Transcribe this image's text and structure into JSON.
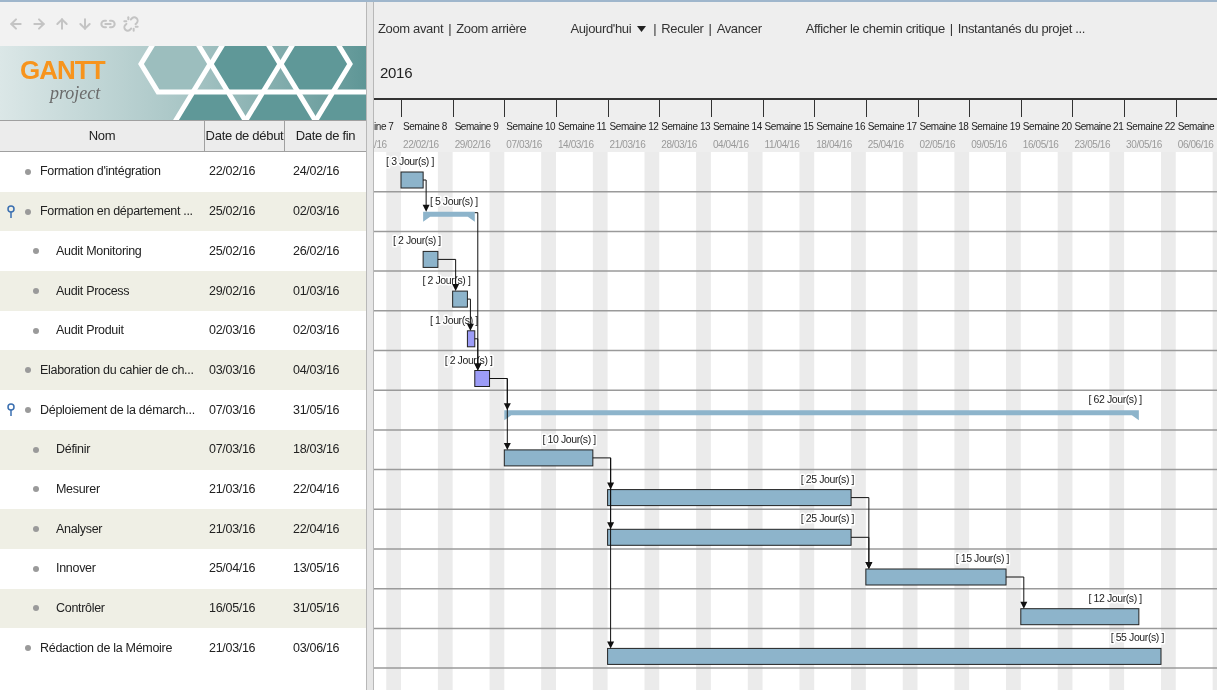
{
  "toolbar": [
    {
      "disabled": true
    },
    {
      "disabled": true
    },
    {
      "disabled": true
    },
    {
      "disabled": true
    },
    {
      "disabled": true
    },
    {
      "disabled": true
    }
  ],
  "logo": {
    "title": "GANTT",
    "subtitle": "project"
  },
  "table": {
    "columns": [
      "Nom",
      "Date de début",
      "Date de fin"
    ],
    "rows": [
      {
        "name": "Formation d'intégration",
        "start": "22/02/16",
        "end": "24/02/16",
        "duration": "[ 3 Jour(s) ]",
        "color": "#8db4cb",
        "arrow_in": false
      },
      {
        "name": "Formation en département ...",
        "start": "25/02/16",
        "end": "02/03/16",
        "duration": "[ 5 Jour(s) ]",
        "arrow_in": true,
        "expanded": true,
        "children": [
          {
            "name": "Audit Monitoring",
            "start": "25/02/16",
            "end": "26/02/16",
            "duration": "[ 2 Jour(s) ]",
            "color": "#8db4cb",
            "arrow_in": false
          },
          {
            "name": "Audit Process",
            "start": "29/02/16",
            "end": "01/03/16",
            "duration": "[ 2 Jour(s) ]",
            "color": "#8db4cb",
            "arrow_in": true
          },
          {
            "name": "Audit Produit",
            "start": "02/03/16",
            "end": "02/03/16",
            "duration": "[ 1 Jour(s) ]",
            "color": "#9c9cf7",
            "arrow_in": true
          }
        ]
      },
      {
        "name": "Elaboration du cahier de ch...",
        "start": "03/03/16",
        "end": "04/03/16",
        "duration": "[ 2 Jour(s) ]",
        "color": "#9c9cf7",
        "arrow_in": true
      },
      {
        "name": "Déploiement de la démarch...",
        "start": "07/03/16",
        "end": "31/05/16",
        "duration": "[ 62 Jour(s) ]",
        "arrow_in": true,
        "expanded": true,
        "children": [
          {
            "name": "Définir",
            "start": "07/03/16",
            "end": "18/03/16",
            "duration": "[ 10 Jour(s) ]",
            "color": "#8db4cb",
            "arrow_in": true
          },
          {
            "name": "Mesurer",
            "start": "21/03/16",
            "end": "22/04/16",
            "duration": "[ 25 Jour(s) ]",
            "color": "#8db4cb",
            "arrow_in": true
          },
          {
            "name": "Analyser",
            "start": "21/03/16",
            "end": "22/04/16",
            "duration": "[ 25 Jour(s) ]",
            "color": "#8db4cb",
            "arrow_in": true
          },
          {
            "name": "Innover",
            "start": "25/04/16",
            "end": "13/05/16",
            "duration": "[ 15 Jour(s) ]",
            "color": "#8db4cb",
            "arrow_in": true
          },
          {
            "name": "Contrôler",
            "start": "16/05/16",
            "end": "31/05/16",
            "duration": "[ 12 Jour(s) ]",
            "color": "#8db4cb",
            "arrow_in": true
          }
        ]
      },
      {
        "name": "Rédaction de la Mémoire",
        "start": "21/03/16",
        "end": "03/06/16",
        "duration": "[ 55 Jour(s) ]",
        "color": "#8db4cb",
        "arrow_in": true
      }
    ]
  },
  "chart_toolbar": {
    "separator": "|",
    "groups": [
      [
        {
          "label": "Zoom avant",
          "kind": "link"
        },
        {
          "label": "Zoom arrière",
          "kind": "link"
        }
      ],
      [
        {
          "label": "Aujourd'hui",
          "kind": "dropdown"
        },
        {
          "label": "Reculer",
          "kind": "link"
        },
        {
          "label": "Avancer",
          "kind": "link"
        }
      ],
      [
        {
          "label": "Afficher le chemin critique",
          "kind": "link"
        },
        {
          "label": "Instantanés du projet ...",
          "kind": "link"
        }
      ]
    ]
  },
  "timeline": {
    "year": "2016",
    "weeks": [
      {
        "label": "ine 7",
        "date": "/16"
      },
      {
        "label": "Semaine 8",
        "date": "22/02/16"
      },
      {
        "label": "Semaine 9",
        "date": "29/02/16"
      },
      {
        "label": "Semaine 10",
        "date": "07/03/16"
      },
      {
        "label": "Semaine 11",
        "date": "14/03/16"
      },
      {
        "label": "Semaine 12",
        "date": "21/03/16"
      },
      {
        "label": "Semaine 13",
        "date": "28/03/16"
      },
      {
        "label": "Semaine 14",
        "date": "04/04/16"
      },
      {
        "label": "Semaine 15",
        "date": "11/04/16"
      },
      {
        "label": "Semaine 16",
        "date": "18/04/16"
      },
      {
        "label": "Semaine 17",
        "date": "25/04/16"
      },
      {
        "label": "Semaine 18",
        "date": "02/05/16"
      },
      {
        "label": "Semaine 19",
        "date": "09/05/16"
      },
      {
        "label": "Semaine 20",
        "date": "16/05/16"
      },
      {
        "label": "Semaine 21",
        "date": "23/05/16"
      },
      {
        "label": "Semaine 22",
        "date": "30/05/16"
      },
      {
        "label": "Semaine",
        "date": "06/06/16"
      }
    ]
  }
}
